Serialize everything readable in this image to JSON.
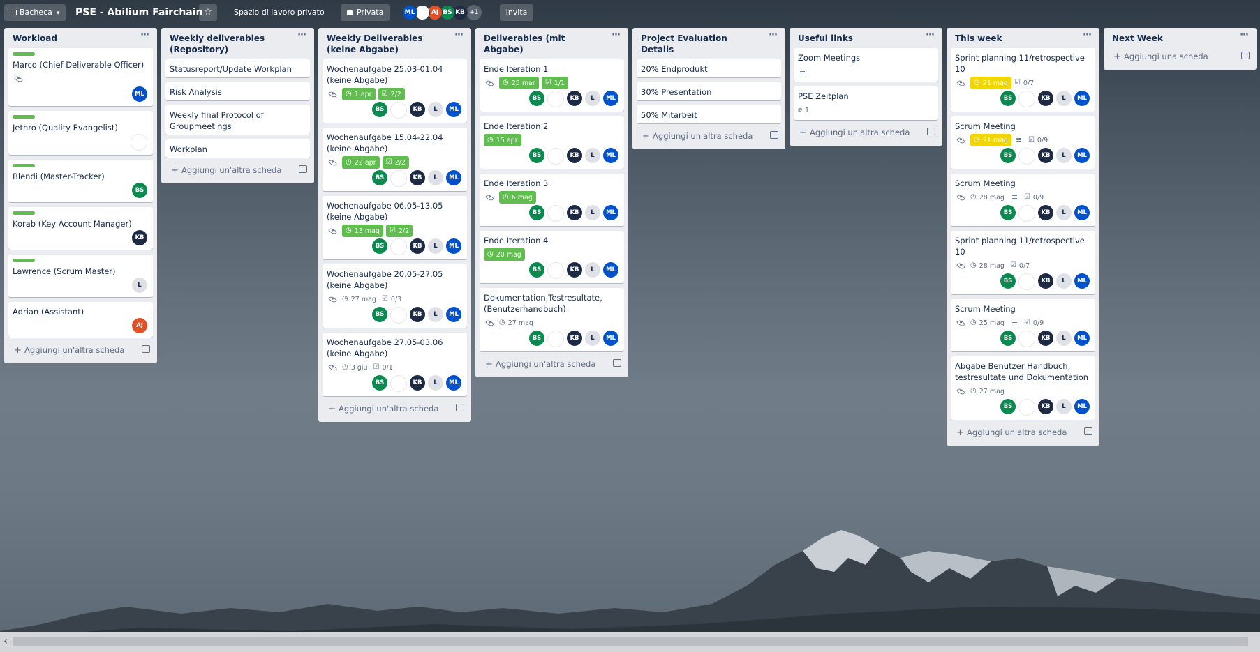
{
  "topbar": {
    "boards_label": "Bacheca",
    "board_title": "PSE - Abilium Fairchain",
    "workspace": "Spazio di lavoro privato",
    "visibility": "Privata",
    "invite": "Invita",
    "members": [
      {
        "initials": "ML",
        "color": "#0052cc"
      },
      {
        "initials": "",
        "color": "#ffffff"
      },
      {
        "initials": "AJ",
        "color": "#e34f26"
      },
      {
        "initials": "BS",
        "color": "#0a8a4e"
      },
      {
        "initials": "KB",
        "color": "#1e2a44"
      }
    ],
    "extra_members": "+1"
  },
  "lists": [
    {
      "title": "Workload",
      "cards": [
        {
          "label": true,
          "title": "Marco (Chief Deliverable Officer)",
          "watch": true,
          "members": [
            "ML"
          ]
        },
        {
          "label": true,
          "title": "Jethro (Quality Evangelist)",
          "members": [
            ""
          ]
        },
        {
          "label": true,
          "title": "Blendi (Master-Tracker)",
          "members": [
            "BS"
          ]
        },
        {
          "label": true,
          "title": "Korab (Key Account Manager)",
          "members": [
            "KB"
          ]
        },
        {
          "label": true,
          "title": "Lawrence (Scrum Master)",
          "members": [
            "L"
          ]
        },
        {
          "title": "Adrian (Assistant)",
          "members": [
            "AJ"
          ]
        }
      ],
      "add": "Aggiungi un'altra scheda"
    },
    {
      "title": "Weekly deliverables (Repository)",
      "cards": [
        {
          "title": "Statusreport/Update Workplan"
        },
        {
          "title": "Risk Analysis"
        },
        {
          "title": "Weekly final Protocol of Groupmeetings"
        },
        {
          "title": "Workplan"
        }
      ],
      "add": "Aggiungi un'altra scheda"
    },
    {
      "title": "Weekly Deliverables (keine Abgabe)",
      "cards": [
        {
          "title": "Wochenaufgabe 25.03-01.04 (keine Abgabe)",
          "watch": true,
          "due": "1 apr",
          "due_style": "green",
          "check": "2/2",
          "check_style": "green",
          "members": [
            "BS",
            "",
            "KB",
            "L",
            "ML"
          ]
        },
        {
          "title": "Wochenaufgabe 15.04-22.04 (keine Abgabe)",
          "watch": true,
          "due": "22 apr",
          "due_style": "green",
          "check": "2/2",
          "check_style": "green",
          "members": [
            "BS",
            "",
            "KB",
            "L",
            "ML"
          ]
        },
        {
          "title": "Wochenaufgabe 06.05-13.05 (keine Abgabe)",
          "watch": true,
          "due": "13 mag",
          "due_style": "green",
          "check": "2/2",
          "check_style": "green",
          "members": [
            "BS",
            "",
            "KB",
            "L",
            "ML"
          ]
        },
        {
          "title": "Wochenaufgabe 20.05-27.05 (keine Abgabe)",
          "watch": true,
          "due": "27 mag",
          "check": "0/3",
          "members": [
            "BS",
            "",
            "KB",
            "L",
            "ML"
          ]
        },
        {
          "title": "Wochenaufgabe 27.05-03.06 (keine Abgabe)",
          "watch": true,
          "due": "3 giu",
          "check": "0/1",
          "members": [
            "BS",
            "",
            "KB",
            "L",
            "ML"
          ]
        }
      ],
      "add": "Aggiungi un'altra scheda"
    },
    {
      "title": "Deliverables (mit Abgabe)",
      "cards": [
        {
          "title": "Ende Iteration 1",
          "watch": true,
          "due": "25 mar",
          "due_style": "green",
          "check": "1/1",
          "check_style": "green",
          "members": [
            "BS",
            "",
            "KB",
            "L",
            "ML"
          ]
        },
        {
          "title": "Ende Iteration 2",
          "due": "15 apr",
          "due_style": "green",
          "members": [
            "BS",
            "",
            "KB",
            "L",
            "ML"
          ]
        },
        {
          "title": "Ende Iteration 3",
          "watch": true,
          "due": "6 mag",
          "due_style": "green",
          "members": [
            "BS",
            "",
            "KB",
            "L",
            "ML"
          ]
        },
        {
          "title": "Ende Iteration 4",
          "due": "20 mag",
          "due_style": "green",
          "members": [
            "BS",
            "",
            "KB",
            "L",
            "ML"
          ]
        },
        {
          "title": "Dokumentation,Testresultate, (Benutzerhandbuch)",
          "watch": true,
          "due": "27 mag",
          "members": [
            "BS",
            "",
            "KB",
            "L",
            "ML"
          ]
        }
      ],
      "add": "Aggiungi un'altra scheda"
    },
    {
      "title": "Project Evaluation Details",
      "cards": [
        {
          "title": "20% Endprodukt"
        },
        {
          "title": "30% Presentation"
        },
        {
          "title": "50% Mitarbeit"
        }
      ],
      "add": "Aggiungi un'altra scheda"
    },
    {
      "title": "Useful links",
      "cards": [
        {
          "title": "Zoom Meetings",
          "desc": true
        },
        {
          "title": "PSE Zeitplan",
          "attach": "1"
        }
      ],
      "add": "Aggiungi un'altra scheda"
    },
    {
      "title": "This week",
      "cards": [
        {
          "title": "Sprint planning 11/retrospective 10",
          "watch": true,
          "due": "21 mag",
          "due_style": "yellow",
          "check": "0/7",
          "members": [
            "BS",
            "",
            "KB",
            "L",
            "ML"
          ]
        },
        {
          "title": "Scrum Meeting",
          "watch": true,
          "due": "21 mag",
          "due_style": "yellow",
          "desc": true,
          "check": "0/9",
          "members": [
            "BS",
            "",
            "KB",
            "L",
            "ML"
          ]
        },
        {
          "title": "Scrum Meeting",
          "watch": true,
          "due": "28 mag",
          "desc": true,
          "check": "0/9",
          "members": [
            "BS",
            "",
            "KB",
            "L",
            "ML"
          ]
        },
        {
          "title": "Sprint planning 11/retrospective 10",
          "watch": true,
          "due": "28 mag",
          "check": "0/7",
          "members": [
            "BS",
            "",
            "KB",
            "L",
            "ML"
          ]
        },
        {
          "title": "Scrum Meeting",
          "watch": true,
          "due": "25 mag",
          "desc": true,
          "check": "0/9",
          "members": [
            "BS",
            "",
            "KB",
            "L",
            "ML"
          ]
        },
        {
          "title": "Abgabe Benutzer Handbuch, testresultate und Dokumentation",
          "watch": true,
          "due": "27 mag",
          "members": [
            "BS",
            "",
            "KB",
            "L",
            "ML"
          ]
        }
      ],
      "add": "Aggiungi un'altra scheda"
    },
    {
      "title": "Next Week",
      "cards": [],
      "add": "Aggiungi una scheda"
    }
  ]
}
